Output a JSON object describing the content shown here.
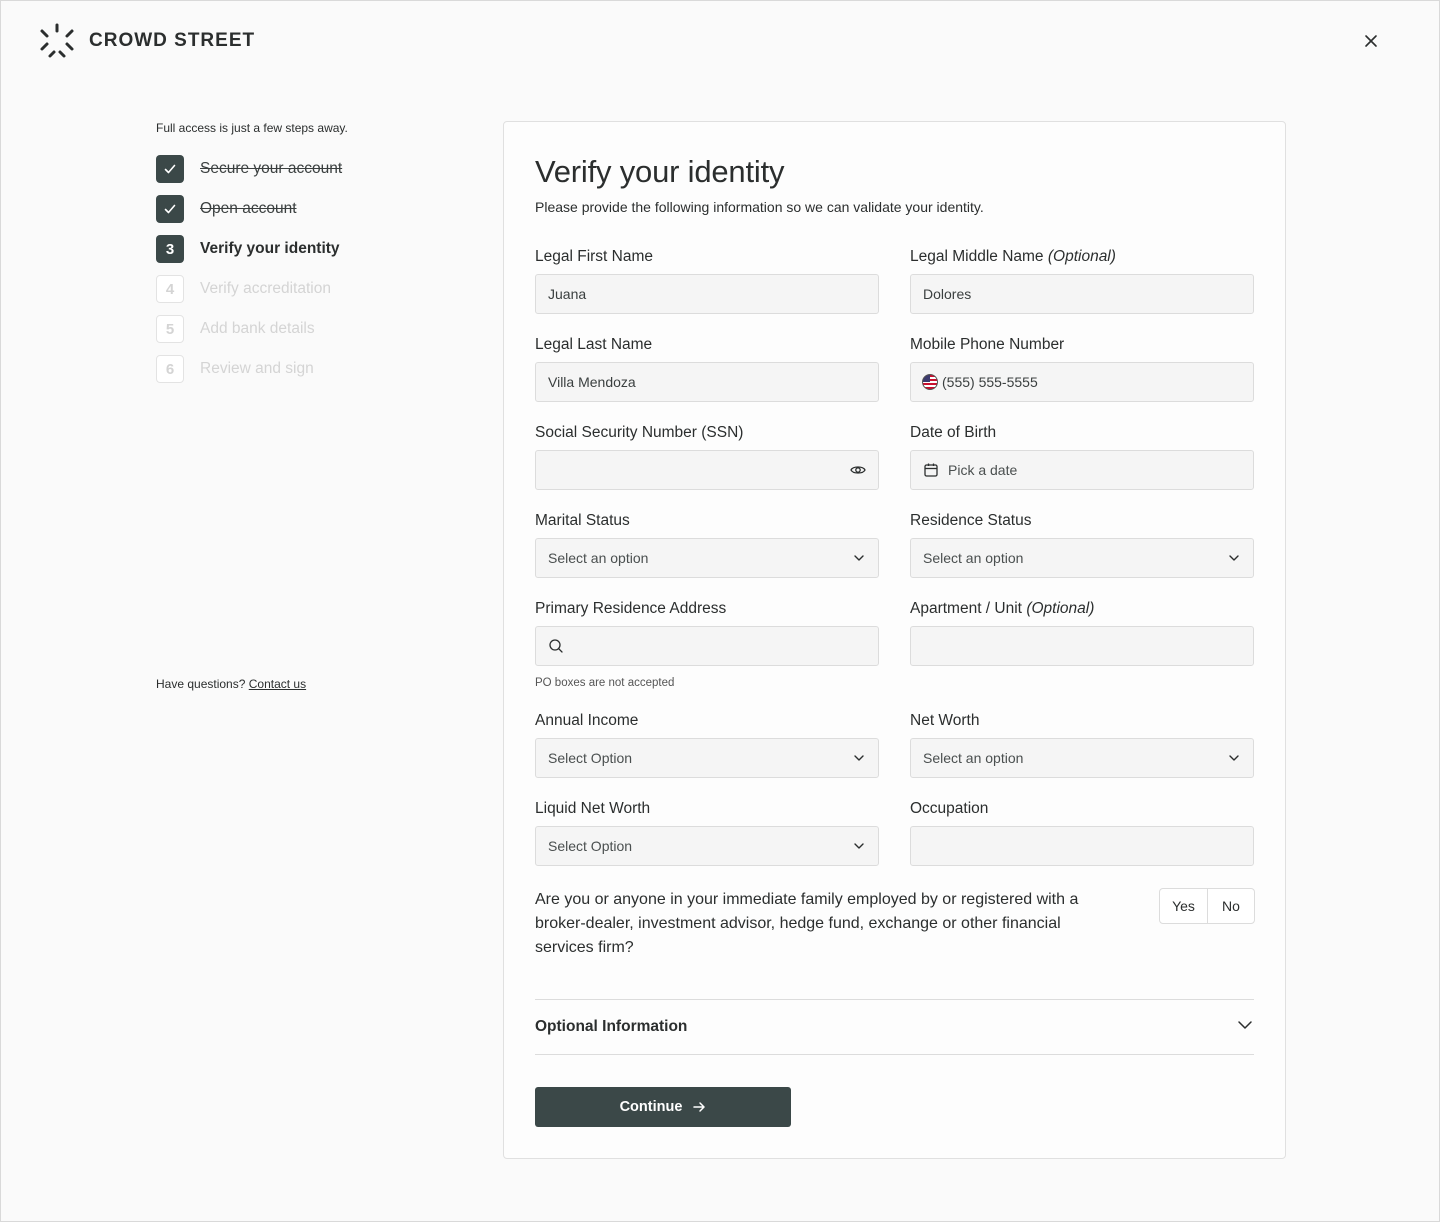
{
  "brand": {
    "name": "CROWD STREET"
  },
  "sidebar": {
    "intro": "Full access is just a few steps away.",
    "steps": [
      {
        "number": "",
        "label": "Secure your account",
        "state": "done"
      },
      {
        "number": "",
        "label": "Open account",
        "state": "done"
      },
      {
        "number": "3",
        "label": "Verify your identity",
        "state": "current"
      },
      {
        "number": "4",
        "label": "Verify accreditation",
        "state": "future"
      },
      {
        "number": "5",
        "label": "Add bank details",
        "state": "future"
      },
      {
        "number": "6",
        "label": "Review and sign",
        "state": "future"
      }
    ],
    "help_text": "Have questions?",
    "help_link": "Contact us"
  },
  "form": {
    "title": "Verify your identity",
    "subtitle": "Please provide the following information so we can validate your identity.",
    "first_name": {
      "label": "Legal First Name",
      "value": "Juana"
    },
    "middle_name": {
      "label": "Legal Middle Name",
      "label_optional": "(Optional)",
      "value": "Dolores"
    },
    "last_name": {
      "label": "Legal Last Name",
      "value": "Villa Mendoza"
    },
    "phone": {
      "label": "Mobile Phone Number",
      "value": "(555) 555-5555"
    },
    "ssn": {
      "label": "Social Security Number (SSN)",
      "value": ""
    },
    "dob": {
      "label": "Date of Birth",
      "placeholder": "Pick a date"
    },
    "marital": {
      "label": "Marital Status",
      "placeholder": "Select an option"
    },
    "residence": {
      "label": "Residence Status",
      "placeholder": "Select an option"
    },
    "address": {
      "label": "Primary Residence Address",
      "value": "",
      "hint": "PO boxes are not accepted"
    },
    "apartment": {
      "label": "Apartment / Unit",
      "label_optional": "(Optional)",
      "value": ""
    },
    "income": {
      "label": "Annual Income",
      "placeholder": "Select Option"
    },
    "net_worth": {
      "label": "Net Worth",
      "placeholder": "Select an option"
    },
    "liquid_net_worth": {
      "label": "Liquid Net Worth",
      "placeholder": "Select Option"
    },
    "occupation": {
      "label": "Occupation",
      "value": ""
    },
    "question": "Are you or anyone in your immediate family employed by or registered with a broker-dealer, investment advisor, hedge fund, exchange or other financial services firm?",
    "yes_label": "Yes",
    "no_label": "No",
    "optional_section": "Optional Information",
    "continue_label": "Continue"
  },
  "colors": {
    "primary": "#3b4848",
    "muted": "#d4d4d4",
    "input_bg": "#f5f5f5"
  }
}
